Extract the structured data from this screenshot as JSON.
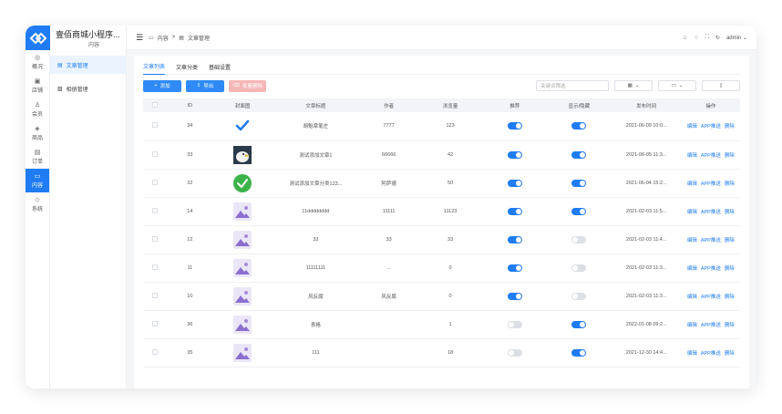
{
  "app": {
    "title": "壹佰商城小程序...",
    "subtitle": "内容"
  },
  "rail": [
    {
      "label": "概况",
      "icon": "dashboard-icon",
      "glyph": "◎",
      "active": false
    },
    {
      "label": "店铺",
      "icon": "store-icon",
      "glyph": "▣",
      "active": false
    },
    {
      "label": "会员",
      "icon": "user-icon",
      "glyph": "♙",
      "active": false
    },
    {
      "label": "商品",
      "icon": "goods-icon",
      "glyph": "◈",
      "active": false
    },
    {
      "label": "订单",
      "icon": "order-icon",
      "glyph": "▤",
      "active": false
    },
    {
      "label": "内容",
      "icon": "folder-icon",
      "glyph": "▭",
      "active": true
    },
    {
      "label": "系统",
      "icon": "settings-icon",
      "glyph": "◇",
      "active": false
    }
  ],
  "subnav": [
    {
      "label": "文章管理",
      "active": true,
      "icon": "article-icon",
      "glyph": "▤"
    },
    {
      "label": "相册管理",
      "active": false,
      "icon": "album-icon",
      "glyph": "▧"
    }
  ],
  "header": {
    "breadcrumb": [
      "内容",
      "文章管理"
    ],
    "user": "admin"
  },
  "tabs": [
    "文章列表",
    "文章分类",
    "基础设置"
  ],
  "toolbar": {
    "add": "添加",
    "export": "导出",
    "batch_delete": "批量删除",
    "search_placeholder": "关键词筛选"
  },
  "columns": [
    "ID",
    "封面图",
    "文章标题",
    "作者",
    "浏览量",
    "推荐",
    "显示/隐藏",
    "发布时间",
    "操作"
  ],
  "actions": [
    "编辑",
    "APP推送",
    "删除"
  ],
  "rows": [
    {
      "id": "34",
      "cover": "check-blue",
      "title": "胡魁章笔庄",
      "author": "7777",
      "views": "123",
      "recommend": true,
      "visible": true,
      "time": "2021-06-09 10:0..."
    },
    {
      "id": "33",
      "cover": "eagle",
      "title": "测试添加文章1",
      "author": "66666",
      "views": "42",
      "recommend": true,
      "visible": true,
      "time": "2021-06-05 11:3..."
    },
    {
      "id": "32",
      "cover": "check-green",
      "title": "测试添加文章分类123...",
      "author": "阿萨德",
      "views": "50",
      "recommend": true,
      "visible": true,
      "time": "2021-06-04 15:2..."
    },
    {
      "id": "14",
      "cover": "placeholder",
      "title": "11dddddddd",
      "author": "11111",
      "views": "11123",
      "recommend": true,
      "visible": true,
      "time": "2021-02-03 11:5..."
    },
    {
      "id": "12",
      "cover": "placeholder",
      "title": "33",
      "author": "33",
      "views": "33",
      "recommend": true,
      "visible": false,
      "time": "2021-02-03 11:4..."
    },
    {
      "id": "11",
      "cover": "placeholder",
      "title": "11111111",
      "author": "...",
      "views": "0",
      "recommend": true,
      "visible": false,
      "time": "2021-02-03 11:3..."
    },
    {
      "id": "10",
      "cover": "placeholder",
      "title": "风反腐",
      "author": "风反腐",
      "views": "0",
      "recommend": true,
      "visible": false,
      "time": "2021-02-03 11:3..."
    },
    {
      "id": "36",
      "cover": "placeholder",
      "title": "表格",
      "author": "",
      "views": "1",
      "recommend": false,
      "visible": true,
      "time": "2022-01-08 09:2..."
    },
    {
      "id": "35",
      "cover": "placeholder",
      "title": "111",
      "author": "",
      "views": "18",
      "recommend": false,
      "visible": true,
      "time": "2021-12-30 14:4..."
    }
  ],
  "colors": {
    "accent": "#1f7cf2",
    "danger_light": "#f5b6b6",
    "switch_off": "#dcdfe6"
  }
}
